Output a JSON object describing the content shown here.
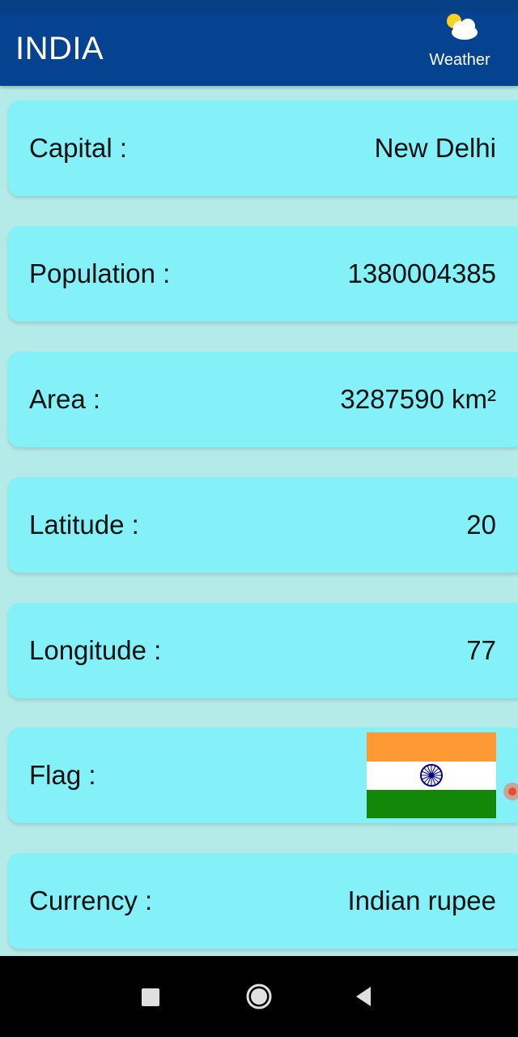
{
  "appbar": {
    "title": "INDIA",
    "background": "#05428f",
    "weather": {
      "label": "Weather",
      "icon": "partly-cloudy-icon"
    }
  },
  "details": [
    {
      "label": "Capital :",
      "value": "New Delhi"
    },
    {
      "label": "Population :",
      "value": "1380004385"
    },
    {
      "label": "Area :",
      "value": "3287590 km²"
    },
    {
      "label": "Latitude :",
      "value": "20"
    },
    {
      "label": "Longitude :",
      "value": "77"
    },
    {
      "label": "Flag :",
      "icon": "india-flag-image"
    },
    {
      "label": "Currency :",
      "value": "Indian rupee"
    }
  ],
  "colors": {
    "page_background": "#b4ebe8",
    "card_background": "#84f0f8",
    "flag_saffron": "#ff9933",
    "flag_white": "#ffffff",
    "flag_green": "#138808",
    "flag_chakra": "#000080"
  },
  "navbar": {
    "buttons": [
      "recents-square-icon",
      "home-circle-icon",
      "back-triangle-icon"
    ]
  }
}
